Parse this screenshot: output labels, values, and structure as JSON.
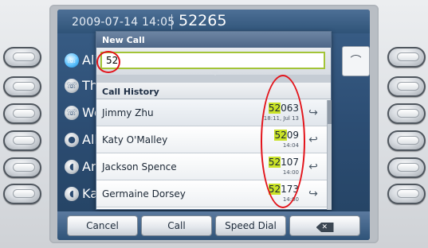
{
  "status_bar": {
    "datetime": "2009-07-14 14:05",
    "extension": "52265"
  },
  "background_lines": [
    {
      "icon": "handset-icon",
      "label": "Ali",
      "active": true
    },
    {
      "icon": "handset-icon",
      "label": "Th",
      "active": false
    },
    {
      "icon": "handset-icon",
      "label": "We",
      "active": false
    },
    {
      "icon": "voicemail-icon",
      "label": "All",
      "active": false
    },
    {
      "icon": "speaker-icon",
      "label": "An",
      "active": false
    },
    {
      "icon": "speaker-icon",
      "label": "Ka",
      "active": false
    }
  ],
  "new_call": {
    "title": "New Call",
    "input_value": "52"
  },
  "call_history": {
    "header": "Call History",
    "rows": [
      {
        "name": "Jimmy Zhu",
        "match": "52",
        "rest": "063",
        "time": "18:11, Jul 13",
        "icon": "outgoing-call-icon"
      },
      {
        "name": "Katy O'Malley",
        "match": "52",
        "rest": "09",
        "time": "14:04",
        "icon": "incoming-call-icon"
      },
      {
        "name": "Jackson Spence",
        "match": "52",
        "rest": "107",
        "time": "14:00",
        "icon": "incoming-call-icon"
      },
      {
        "name": "Germaine Dorsey",
        "match": "52",
        "rest": "173",
        "time": "14:00",
        "icon": "outgoing-call-icon"
      }
    ]
  },
  "softkeys": [
    {
      "label": "Cancel"
    },
    {
      "label": "Call"
    },
    {
      "label": "Speed Dial"
    },
    {
      "label": "",
      "icon": "backspace-icon"
    }
  ],
  "colors": {
    "match_highlight": "#c9e227",
    "input_border": "#a3c437",
    "annotation": "#e3141b"
  }
}
